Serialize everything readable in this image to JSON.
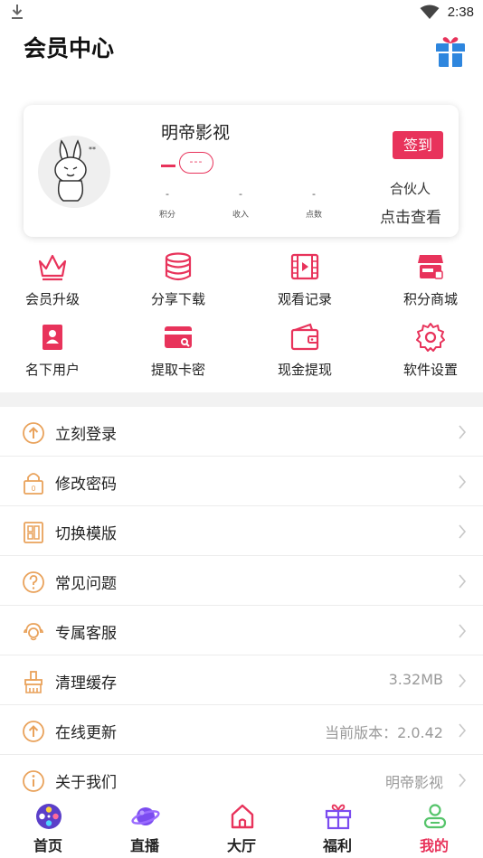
{
  "status": {
    "time": "2:38"
  },
  "header": {
    "title": "会员中心"
  },
  "profile": {
    "name": "明帝影视",
    "vip_badge": "---",
    "stats": [
      {
        "value": "-",
        "label": "积分"
      },
      {
        "value": "-",
        "label": "收入"
      },
      {
        "value": "-",
        "label": "点数"
      }
    ],
    "signin_label": "签到",
    "partner_label": "合伙人",
    "view_label": "点击查看"
  },
  "grid": [
    {
      "label": "会员升级",
      "icon": "crown-icon"
    },
    {
      "label": "分享下载",
      "icon": "database-icon"
    },
    {
      "label": "观看记录",
      "icon": "film-icon"
    },
    {
      "label": "积分商城",
      "icon": "shop-icon"
    },
    {
      "label": "名下用户",
      "icon": "user-card-icon"
    },
    {
      "label": "提取卡密",
      "icon": "card-icon"
    },
    {
      "label": "现金提现",
      "icon": "wallet-icon"
    },
    {
      "label": "软件设置",
      "icon": "gear-icon"
    }
  ],
  "menu": [
    {
      "label": "立刻登录",
      "value": "",
      "icon": "login-icon"
    },
    {
      "label": "修改密码",
      "value": "",
      "icon": "lock-icon"
    },
    {
      "label": "切换模版",
      "value": "",
      "icon": "template-icon"
    },
    {
      "label": "常见问题",
      "value": "",
      "icon": "question-icon"
    },
    {
      "label": "专属客服",
      "value": "",
      "icon": "headset-icon"
    },
    {
      "label": "清理缓存",
      "value": "3.32MB",
      "icon": "broom-icon"
    },
    {
      "label": "在线更新",
      "value": "当前版本：2.0.42",
      "icon": "update-icon"
    },
    {
      "label": "关于我们",
      "value": "明帝影视",
      "icon": "info-icon"
    }
  ],
  "tabs": [
    {
      "label": "首页",
      "icon": "film-reel-icon",
      "active": false
    },
    {
      "label": "直播",
      "icon": "planet-icon",
      "active": false
    },
    {
      "label": "大厅",
      "icon": "home-icon",
      "active": false
    },
    {
      "label": "福利",
      "icon": "gift-icon",
      "active": false
    },
    {
      "label": "我的",
      "icon": "profile-icon",
      "active": true
    }
  ],
  "colors": {
    "accent": "#e8335b",
    "icon_orange": "#e9a25b"
  }
}
